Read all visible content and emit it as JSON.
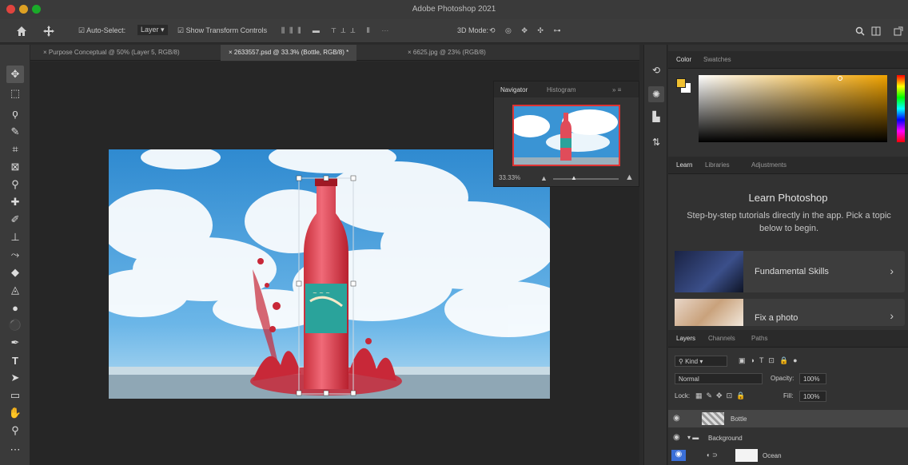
{
  "window": {
    "title": "Adobe Photoshop 2021",
    "traffic_colors": [
      "#e0443e",
      "#dea123",
      "#1aab29"
    ]
  },
  "options_bar": {
    "auto_select_label": "Auto-Select:",
    "auto_select_value": "Layer",
    "show_transform_label": "Show Transform Controls",
    "mode_3d_label": "3D Mode:"
  },
  "tabs": [
    {
      "label": "Purpose Conceptual @ 50% (Layer 5, RGB/8)"
    },
    {
      "label": "2633557.psd @ 33.3% (Bottle, RGB/8) *"
    },
    {
      "label": "6625.jpg @ 23% (RGB/8)"
    }
  ],
  "navigator": {
    "tab_navigator": "Navigator",
    "tab_histogram": "Histogram",
    "zoom": "33.33%"
  },
  "color_panel": {
    "tab_color": "Color",
    "tab_swatches": "Swatches",
    "foreground": "#f0c030",
    "background": "#ffffff"
  },
  "learn_panel": {
    "tab_learn": "Learn",
    "tab_libraries": "Libraries",
    "tab_adjustments": "Adjustments",
    "title": "Learn Photoshop",
    "description": "Step-by-step tutorials directly in the app. Pick a topic below to begin.",
    "cards": [
      {
        "label": "Fundamental Skills"
      },
      {
        "label": "Fix a photo"
      }
    ]
  },
  "layers_panel": {
    "tab_layers": "Layers",
    "tab_channels": "Channels",
    "tab_paths": "Paths",
    "kind_label": "Kind",
    "blend_mode": "Normal",
    "opacity_label": "Opacity:",
    "opacity_value": "100%",
    "lock_label": "Lock:",
    "fill_label": "Fill:",
    "fill_value": "100%",
    "layers": [
      {
        "name": "Bottle"
      },
      {
        "name": "Background"
      },
      {
        "name": "Ocean"
      }
    ]
  }
}
